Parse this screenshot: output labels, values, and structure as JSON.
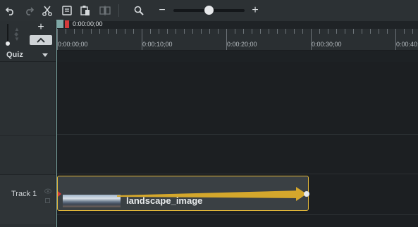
{
  "toolbar": {
    "icons": [
      "undo-icon",
      "redo-icon",
      "cut-icon",
      "copy-icon",
      "paste-icon",
      "split-icon",
      "zoom-search-icon"
    ],
    "zoom_minus": "−",
    "zoom_plus": "+",
    "zoom_level": 0.49
  },
  "left": {
    "add": "+",
    "collapse": "^",
    "quiz_label": "Quiz",
    "track_label": "Track 1"
  },
  "ruler": {
    "playhead_time": "0:00:00;00",
    "labels": [
      "0:00:00;00",
      "0:00:10;00",
      "0:00:20;00",
      "0:00:30;00",
      "0:00:40;00"
    ]
  },
  "clip": {
    "label": "landscape_image"
  },
  "colors": {
    "clip_border": "#e1b73a",
    "arrow": "#d4a72c",
    "playhead": "#7fa8a6",
    "marker": "#d23b3b"
  }
}
